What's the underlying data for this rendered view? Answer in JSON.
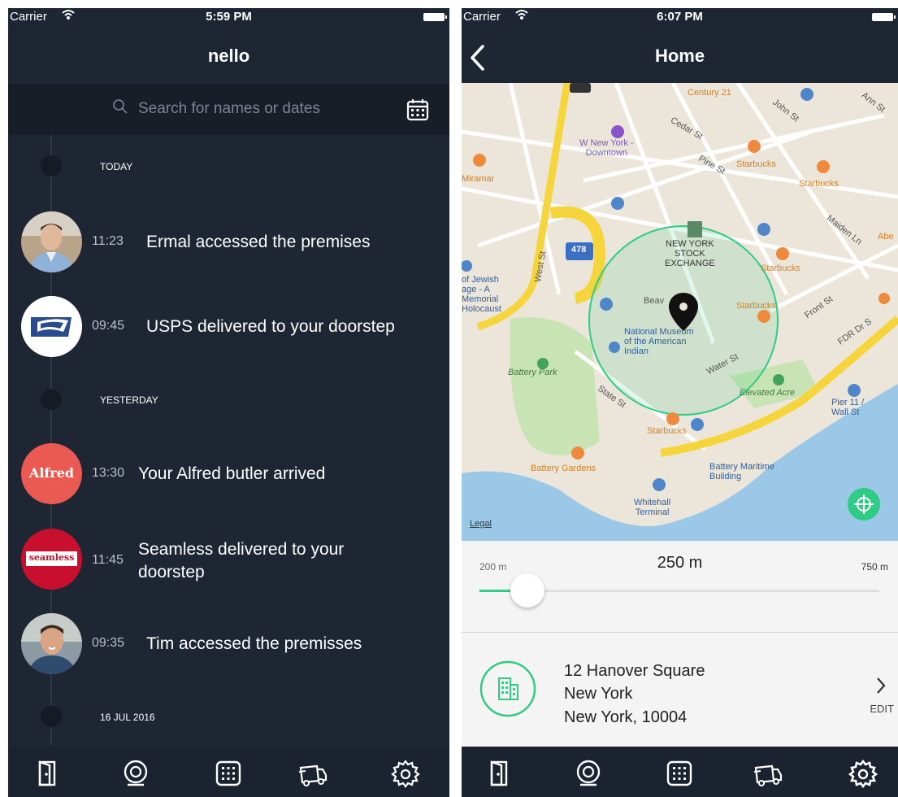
{
  "left": {
    "status": {
      "carrier": "Carrier",
      "time": "5:59 PM"
    },
    "title": "nello",
    "search": {
      "placeholder": "Search for names or dates"
    },
    "timeline": {
      "today": "TODAY",
      "yesterday": "YESTERDAY",
      "earlier": "16 JUL 2016",
      "events": [
        {
          "time": "11:23",
          "text": "Ermal accessed the premises"
        },
        {
          "time": "09:45",
          "text": "USPS delivered to your doorstep"
        },
        {
          "time": "13:30",
          "text": "Your Alfred butler arrived"
        },
        {
          "time": "11:45",
          "text": "Seamless delivered to your doorstep"
        },
        {
          "time": "09:35",
          "text": "Tim accessed the premisses"
        }
      ],
      "logos": {
        "alfred": "Alfred",
        "seamless": "seamless"
      }
    }
  },
  "right": {
    "status": {
      "carrier": "Carrier",
      "time": "6:07 PM"
    },
    "title": "Home",
    "map": {
      "labels": {
        "century21": "Century 21",
        "w_new_york_downtown": "W New York -\nDowntown",
        "starbucks": "Starbucks",
        "miramar": "Miramar",
        "nyse": "NEW YORK\nSTOCK\nEXCHANGE",
        "jewish_museum": "of Jewish\nage - A\nMemorial\nHolocaust",
        "national_museum": "National Museum\nof the American\nIndian",
        "battery_park": "Battery Park",
        "elevated_acre": "Elevated Acre",
        "pier11": "Pier 11 /\nWall St",
        "battery_gardens": "Battery Gardens",
        "battery_maritime": "Battery Maritime\nBuilding",
        "whitehall": "Whitehall\nTerminal",
        "legal": "Legal",
        "highway": "478",
        "fdr": "FDR Dr S",
        "water_st": "Water St",
        "state_st": "State St",
        "front_st": "Front St",
        "maiden_ln": "Maiden Ln",
        "pine_st": "Pine St",
        "cedar_st": "Cedar St",
        "john_st": "John St",
        "ann_st": "Ann St",
        "west_st": "West St",
        "beav": "Beav",
        "abe": "Abe"
      }
    },
    "radius": {
      "min": "200 m",
      "value": "250 m",
      "max": "750 m",
      "fraction": 0.12
    },
    "address": {
      "line1": "12 Hanover Square",
      "line2": "New York",
      "line3": "New York, 10004",
      "edit": "EDIT"
    }
  },
  "tabs": [
    {
      "name": "door-icon"
    },
    {
      "name": "timeline-icon"
    },
    {
      "name": "keypad-icon"
    },
    {
      "name": "delivery-truck-icon"
    },
    {
      "name": "settings-gear-icon"
    }
  ],
  "colors": {
    "dark_bg": "#1e2633",
    "accent": "#2ecc85",
    "map_road": "#f6d53c"
  }
}
